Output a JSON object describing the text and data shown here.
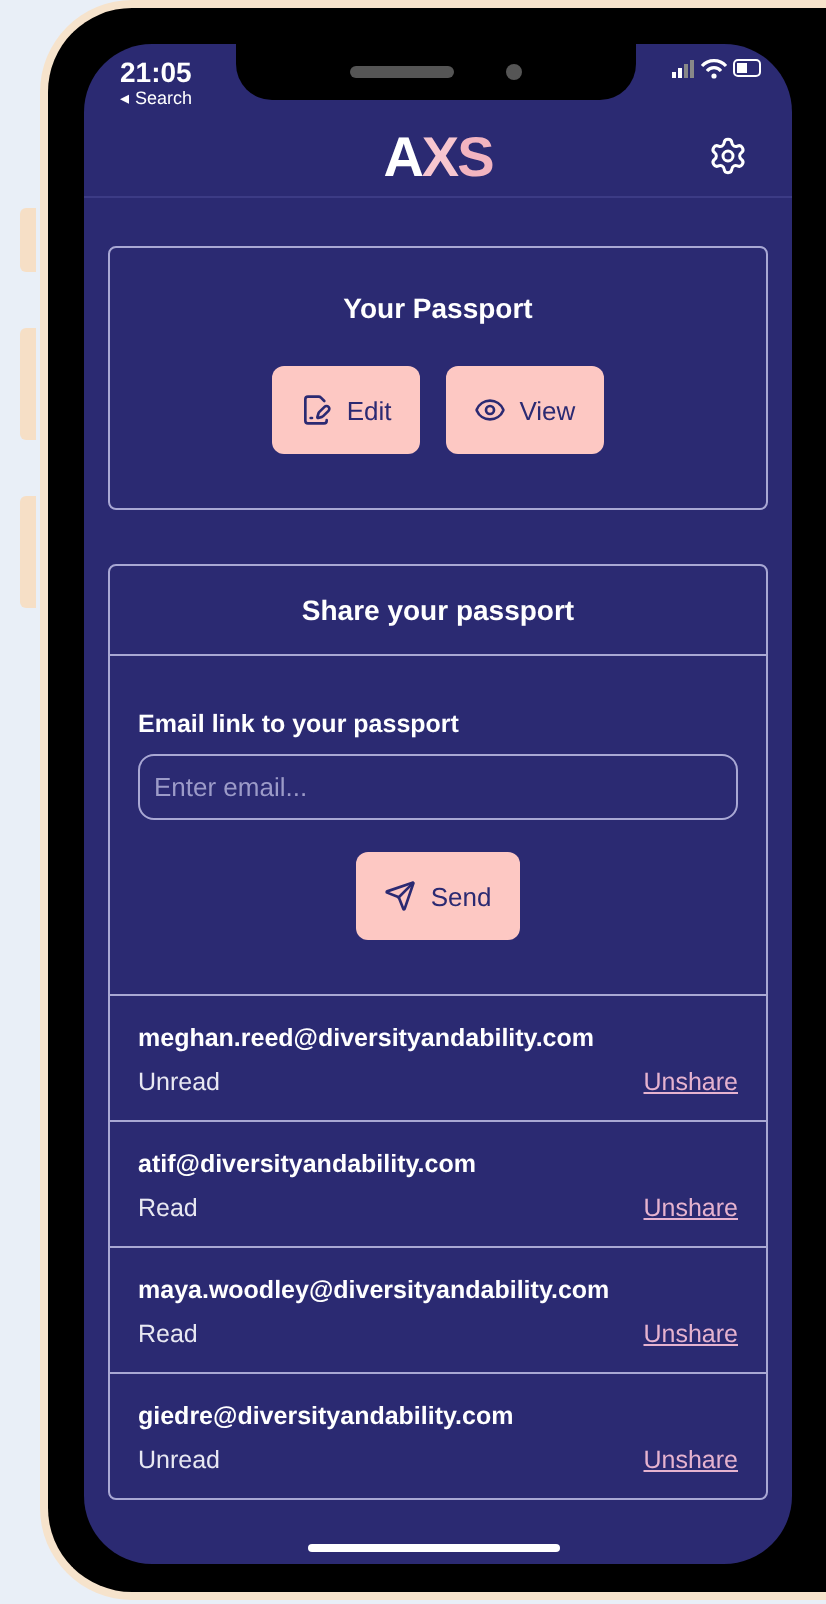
{
  "status_bar": {
    "time": "21:05",
    "back_label": "◂ Search"
  },
  "header": {
    "logo": [
      {
        "text": "A",
        "color": "#ffffff"
      },
      {
        "text": "X",
        "color": "#f7c6cf"
      },
      {
        "text": "S",
        "color": "#f2b4c0"
      }
    ]
  },
  "passport_card": {
    "title": "Your Passport",
    "buttons": [
      {
        "kind": "edit",
        "label": "Edit"
      },
      {
        "kind": "view",
        "label": "View"
      }
    ]
  },
  "share_card": {
    "title": "Share your passport",
    "field_label": "Email link to your passport",
    "placeholder": "Enter email...",
    "send_label": "Send",
    "shares": [
      {
        "email": "meghan.reed@diversityandability.com",
        "status": "Unread",
        "action": "Unshare"
      },
      {
        "email": "atif@diversityandability.com",
        "status": "Read",
        "action": "Unshare"
      },
      {
        "email": "maya.woodley@diversityandability.com",
        "status": "Read",
        "action": "Unshare"
      },
      {
        "email": "giedre@diversityandability.com",
        "status": "Unread",
        "action": "Unshare"
      }
    ]
  }
}
